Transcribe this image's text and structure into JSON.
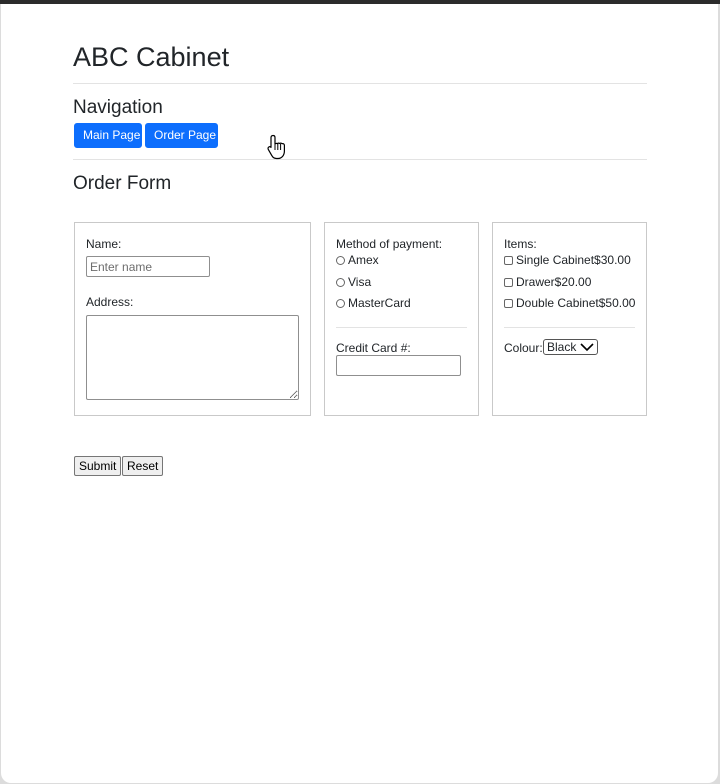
{
  "header": {
    "title": "ABC Cabinet"
  },
  "navigation": {
    "heading": "Navigation",
    "buttons": [
      {
        "label": "Main Page"
      },
      {
        "label": "Order Page"
      }
    ]
  },
  "order_form": {
    "heading": "Order Form",
    "customer": {
      "name_label": "Name:",
      "name_placeholder": "Enter name",
      "name_value": "",
      "address_label": "Address:",
      "address_value": ""
    },
    "payment": {
      "label": "Method of payment:",
      "options": [
        "Amex",
        "Visa",
        "MasterCard"
      ],
      "selected": null,
      "credit_card_label": "Credit Card #:",
      "credit_card_value": ""
    },
    "items": {
      "label": "Items:",
      "options": [
        {
          "label": "Single Cabinet$30.00",
          "checked": false
        },
        {
          "label": "Drawer$20.00",
          "checked": false
        },
        {
          "label": "Double Cabinet$50.00",
          "checked": false
        }
      ],
      "colour_label": "Colour:",
      "colour_value": "Black"
    },
    "submit_label": "Submit",
    "reset_label": "Reset"
  },
  "colors": {
    "primary_button": "#0d6efd",
    "text": "#212529",
    "border": "#c9c9c9"
  }
}
